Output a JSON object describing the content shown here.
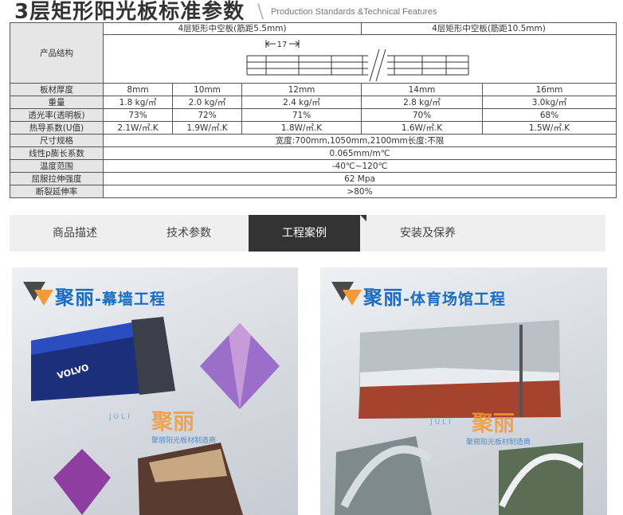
{
  "header": {
    "title": "3层矩形阳光板标准参数",
    "divider": "\\",
    "subtitle": "Production Standards &Technical Features"
  },
  "spec": {
    "structure_label": "产品结构",
    "group_a": "4层矩形中空板(筋距5.5mm)",
    "group_b": "4层矩形中空板(筋距10.5mm)",
    "rib_dimension": "17",
    "rows": [
      {
        "label": "板材厚度",
        "values": [
          "8mm",
          "10mm",
          "12mm",
          "14mm",
          "16mm"
        ]
      },
      {
        "label": "重量",
        "values": [
          "1.8 kg/㎡",
          "2.0 kg/㎡",
          "2.4 kg/㎡",
          "2.8 kg/㎡",
          "3.0kg/㎡"
        ]
      },
      {
        "label": "透光率(透明板)",
        "values": [
          "73%",
          "72%",
          "71%",
          "70%",
          "68%"
        ]
      },
      {
        "label": "热导系数(U值)",
        "values": [
          "2.1W/㎡.K",
          "1.9W/㎡.K",
          "1.8W/㎡.K",
          "1.6W/㎡.K",
          "1.5W/㎡.K"
        ]
      }
    ],
    "span_rows": [
      {
        "label": "尺寸规格",
        "value": "宽度:700mm,1050mm,2100mm长度:不限"
      },
      {
        "label": "线性p膨长系数",
        "value": "0.065mm/m℃"
      },
      {
        "label": "温度范围",
        "value": "-40℃~120℃"
      },
      {
        "label": "屈服拉伸强度",
        "value": "62 Mpa"
      },
      {
        "label": "断裂延伸率",
        "value": ">80%"
      }
    ]
  },
  "tabs": [
    {
      "label": "商品描述"
    },
    {
      "label": "技术参数"
    },
    {
      "label": "工程案例"
    },
    {
      "label": "安装及保养"
    }
  ],
  "panels": [
    {
      "brand": "聚丽",
      "title": "-幕墙工程",
      "wm_brand": "聚丽",
      "wm_juli": "JULI",
      "wm_tag": "聚丽阳光板材制造商",
      "sign": "VOLVO"
    },
    {
      "brand": "聚丽",
      "title": "-体育场馆工程",
      "wm_brand": "聚丽",
      "wm_juli": "JULI",
      "wm_tag": "聚丽阳光板材制造商"
    }
  ],
  "colors": {
    "accent_blue": "#1a6bc2",
    "accent_orange": "#f29a3a",
    "tab_active": "#333333",
    "cell_label": "#e6e6e6"
  }
}
